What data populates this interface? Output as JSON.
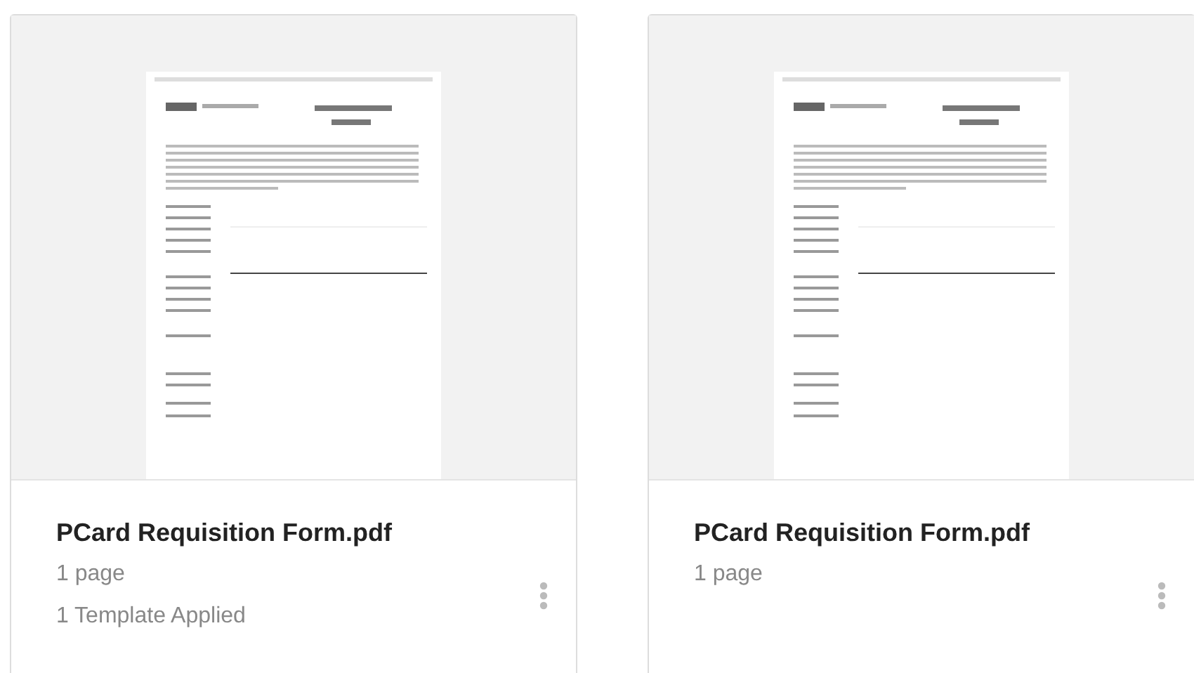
{
  "cards": [
    {
      "title": "PCard Requisition Form.pdf",
      "pages": "1 page",
      "templates": "1 Template Applied"
    },
    {
      "title": "PCard Requisition Form.pdf",
      "pages": "1 page"
    }
  ]
}
